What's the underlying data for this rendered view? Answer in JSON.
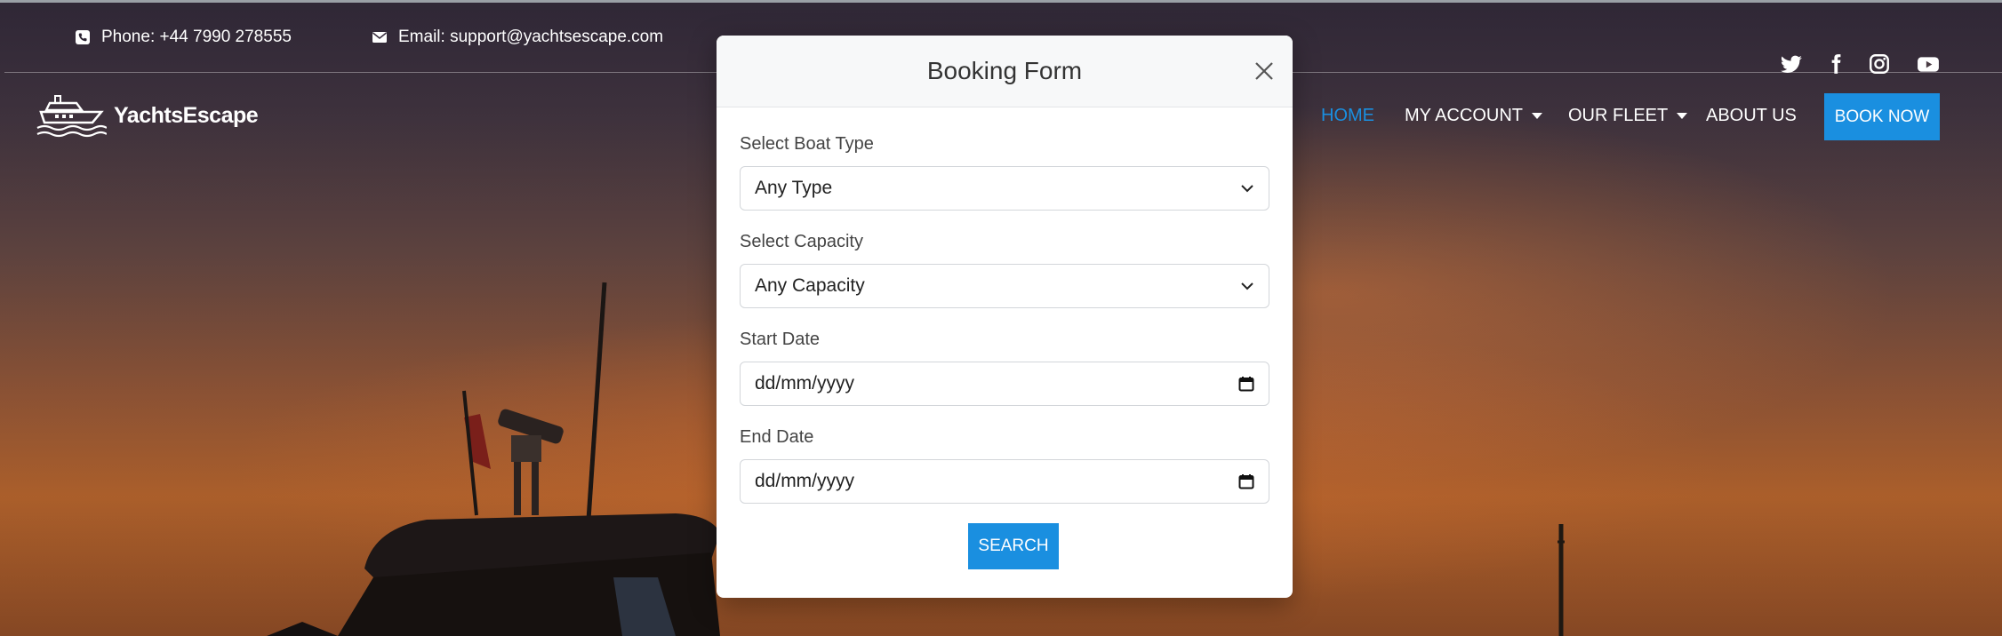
{
  "topbar": {
    "phone": "Phone: +44 7990 278555",
    "email": "Email: support@yachtsescape.com",
    "phone_icon": "phone-icon",
    "email_icon": "envelope-icon",
    "social_icons": [
      "twitter-icon",
      "facebook-icon",
      "instagram-icon",
      "youtube-icon"
    ]
  },
  "brand": {
    "name": "YachtsEscape",
    "logo_icon": "yacht-logo-icon"
  },
  "nav": {
    "home": "HOME",
    "my_account": "MY ACCOUNT",
    "our_fleet": "OUR FLEET",
    "about_us": "ABOUT US",
    "book_now": "BOOK NOW"
  },
  "modal": {
    "title": "Booking Form",
    "boat_type": {
      "label": "Select Boat Type",
      "value": "Any Type"
    },
    "capacity": {
      "label": "Select Capacity",
      "value": "Any Capacity"
    },
    "start_date": {
      "label": "Start Date",
      "placeholder": "dd/mm/yyyy"
    },
    "end_date": {
      "label": "End Date",
      "placeholder": "dd/mm/yyyy"
    },
    "search_label": "SEARCH"
  },
  "colors": {
    "accent": "#1a8fe0",
    "modal_header_bg": "#f7f8f9",
    "text_dark": "#333333"
  }
}
